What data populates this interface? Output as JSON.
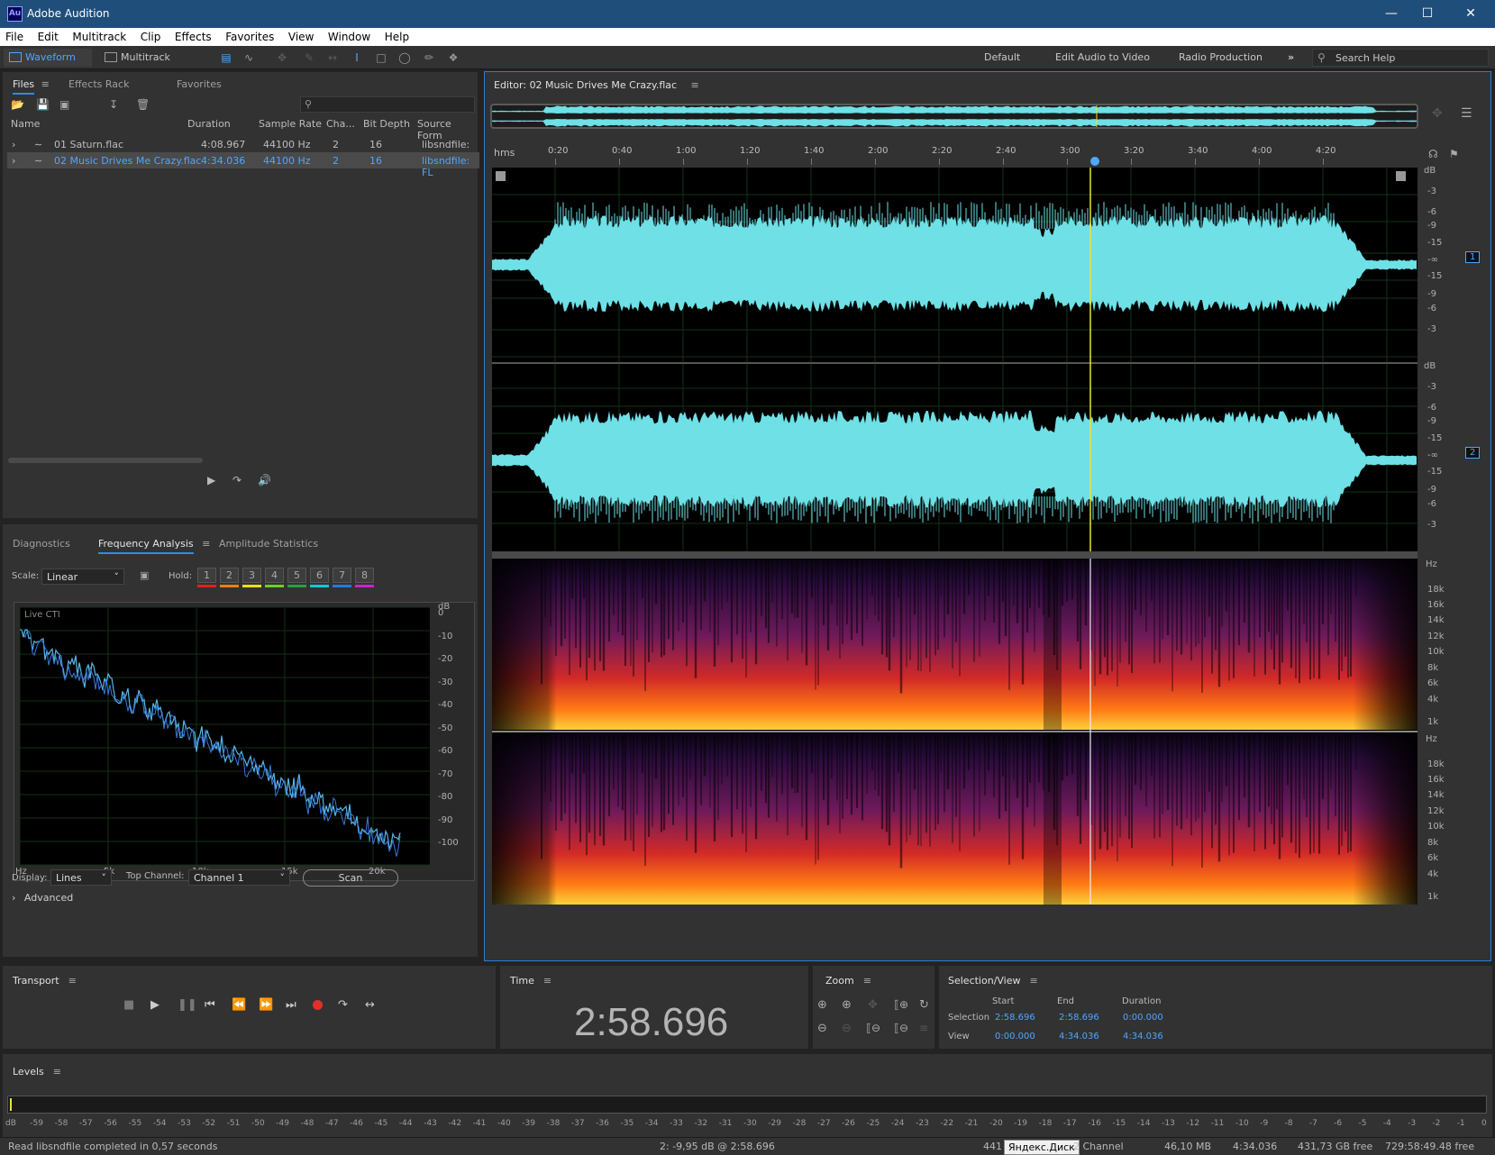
{
  "app": {
    "title": "Adobe Audition",
    "logo": "Au"
  },
  "menu": [
    "File",
    "Edit",
    "Multitrack",
    "Clip",
    "Effects",
    "Favorites",
    "View",
    "Window",
    "Help"
  ],
  "toolbar": {
    "waveform": "Waveform",
    "multitrack": "Multitrack",
    "workspaces": [
      "Default",
      "Edit Audio to Video",
      "Radio Production"
    ],
    "search_placeholder": "Search Help"
  },
  "files_panel": {
    "tabs": [
      "Files",
      "Effects Rack",
      "Favorites"
    ],
    "columns": [
      "Name",
      "Duration",
      "Sample Rate",
      "Cha...",
      "Bit Depth",
      "Source Form"
    ],
    "rows": [
      {
        "name": "01 Saturn.flac",
        "duration": "4:08.967",
        "sample_rate": "44100 Hz",
        "channels": "2",
        "bit_depth": "16",
        "source": "libsndfile: FL"
      },
      {
        "name": "02 Music Drives Me Crazy.flac",
        "duration": "4:34.036",
        "sample_rate": "44100 Hz",
        "channels": "2",
        "bit_depth": "16",
        "source": "libsndfile: FL"
      }
    ]
  },
  "analysis_panel": {
    "tabs": [
      "Diagnostics",
      "Frequency Analysis",
      "Amplitude Statistics"
    ],
    "scale_label": "Scale:",
    "scale_value": "Linear",
    "hold_label": "Hold:",
    "hold_buttons": [
      "1",
      "2",
      "3",
      "4",
      "5",
      "6",
      "7",
      "8"
    ],
    "hold_colors": [
      "#e02020",
      "#f07d10",
      "#e8e010",
      "#6cd020",
      "#28a040",
      "#10c8d8",
      "#2878e0",
      "#d020d0"
    ],
    "live_cti": "Live CTI",
    "db_ticks": [
      "dB",
      "0",
      "-10",
      "-20",
      "-30",
      "-40",
      "-50",
      "-60",
      "-70",
      "-80",
      "-90",
      "-100"
    ],
    "hz_ticks": [
      "Hz",
      "5k",
      "10k",
      "15k",
      "20k"
    ],
    "display_label": "Display:",
    "display_value": "Lines",
    "top_channel_label": "Top Channel:",
    "top_channel_value": "Channel 1",
    "scan": "Scan",
    "advanced": "Advanced"
  },
  "editor": {
    "title": "Editor: 02 Music Drives Me Crazy.flac",
    "time_unit": "hms",
    "time_ticks": [
      "0:20",
      "0:40",
      "1:00",
      "1:20",
      "1:40",
      "2:00",
      "2:20",
      "2:40",
      "3:00",
      "3:20",
      "3:40",
      "4:00",
      "4:20"
    ],
    "db_ticks": [
      "dB",
      "-3",
      "-6",
      "-9",
      "-15",
      "-∞",
      "-15",
      "-9",
      "-6",
      "-3"
    ],
    "hz_ticks": [
      "Hz",
      "18k",
      "16k",
      "14k",
      "12k",
      "10k",
      "8k",
      "6k",
      "4k",
      "1k"
    ],
    "channel_badges": [
      "1",
      "2"
    ]
  },
  "transport": {
    "title": "Transport"
  },
  "time_panel": {
    "title": "Time",
    "value": "2:58.696"
  },
  "zoom_panel": {
    "title": "Zoom"
  },
  "selection_panel": {
    "title": "Selection/View",
    "headers": [
      "Start",
      "End",
      "Duration"
    ],
    "selection": {
      "label": "Selection",
      "start": "2:58.696",
      "end": "2:58.696",
      "duration": "0:00.000"
    },
    "view": {
      "label": "View",
      "start": "0:00.000",
      "end": "4:34.036",
      "duration": "4:34.036"
    }
  },
  "levels": {
    "title": "Levels",
    "ticks": [
      "dB",
      "-59",
      "-58",
      "-57",
      "-56",
      "-55",
      "-54",
      "-53",
      "-52",
      "-51",
      "-50",
      "-49",
      "-48",
      "-47",
      "-46",
      "-45",
      "-44",
      "-43",
      "-42",
      "-41",
      "-40",
      "-39",
      "-38",
      "-37",
      "-36",
      "-35",
      "-34",
      "-33",
      "-32",
      "-31",
      "-30",
      "-29",
      "-28",
      "-27",
      "-26",
      "-25",
      "-24",
      "-23",
      "-22",
      "-21",
      "-20",
      "-19",
      "-18",
      "-17",
      "-16",
      "-15",
      "-14",
      "-13",
      "-12",
      "-11",
      "-10",
      "-9",
      "-8",
      "-7",
      "-6",
      "-5",
      "-4",
      "-3",
      "-2",
      "-1",
      "0"
    ]
  },
  "status": {
    "message": "Read libsndfile completed in 0,57 seconds",
    "cursor": "2: -9,95 dB @ 2:58.696",
    "sample_partial": "441",
    "tooltip": "Яндекс.Диск",
    "channels": "2 Channel",
    "size": "46,10 MB",
    "duration": "4:34.036",
    "free": "431,73 GB free",
    "free_time": "729:58:49.48 free"
  }
}
